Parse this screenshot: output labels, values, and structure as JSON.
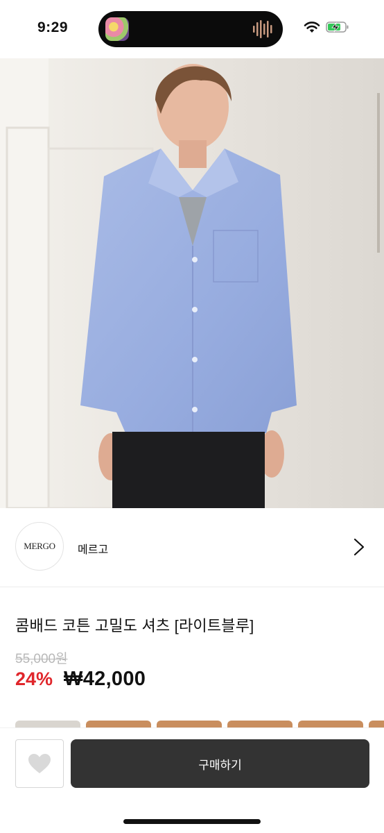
{
  "status_bar": {
    "time": "9:29",
    "icons": [
      "now-playing-artwork",
      "audio-waveform-icon",
      "wifi-icon",
      "battery-charging-icon"
    ],
    "battery_color": "#34c759"
  },
  "hero": {
    "image": "product-photo-light-blue-shirt"
  },
  "store": {
    "logo_text": "MERGO",
    "name": "메르고",
    "chevron_icon": "chevron-right-icon"
  },
  "product": {
    "title": "콤배드 코튼 고밀도 셔츠 [라이트블루]",
    "original_price": "55,000원",
    "discount": "24%",
    "price": "₩42,000",
    "discount_color": "#e0262b"
  },
  "actions": {
    "like_icon": "heart-icon",
    "buy_label": "구매하기",
    "buy_color": "#333333"
  }
}
